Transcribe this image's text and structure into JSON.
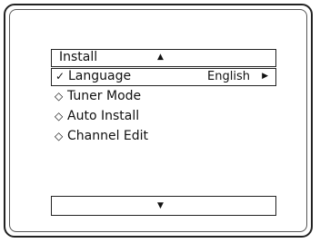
{
  "menu": {
    "title": "Install",
    "up_icon": "▲",
    "down_icon": "▼",
    "items": [
      {
        "mark": "✓",
        "label": "Language",
        "value": "English",
        "arrow": "▶"
      },
      {
        "mark": "◇",
        "label": "Tuner Mode"
      },
      {
        "mark": "◇",
        "label": "Auto Install"
      },
      {
        "mark": "◇",
        "label": "Channel Edit"
      }
    ]
  }
}
